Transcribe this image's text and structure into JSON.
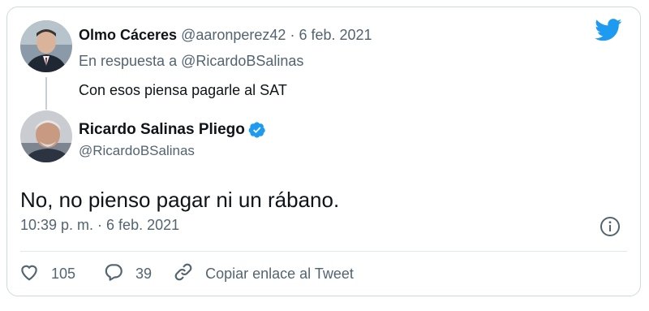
{
  "parent_tweet": {
    "display_name": "Olmo Cáceres",
    "handle": "@aaronperez42",
    "separator": "·",
    "date": "6 feb. 2021",
    "reply_prefix": "En respuesta a ",
    "reply_handle": "@RicardoBSalinas",
    "text": "Con esos piensa pagarle al SAT"
  },
  "main_tweet": {
    "display_name": "Ricardo Salinas Pliego",
    "handle": "@RicardoBSalinas",
    "text": "No, no pienso pagar ni un rábano.",
    "timestamp": "10:39 p. m. · 6 feb. 2021"
  },
  "actions": {
    "likes": "105",
    "replies": "39",
    "copy_link_label": "Copiar enlace al Tweet"
  },
  "colors": {
    "twitter_blue": "#1d9bf0",
    "muted_text": "#536471",
    "border": "#cfd9de"
  },
  "icons": [
    "twitter-bird-icon",
    "verified-badge-icon",
    "info-icon",
    "heart-icon",
    "reply-bubble-icon",
    "link-icon"
  ]
}
